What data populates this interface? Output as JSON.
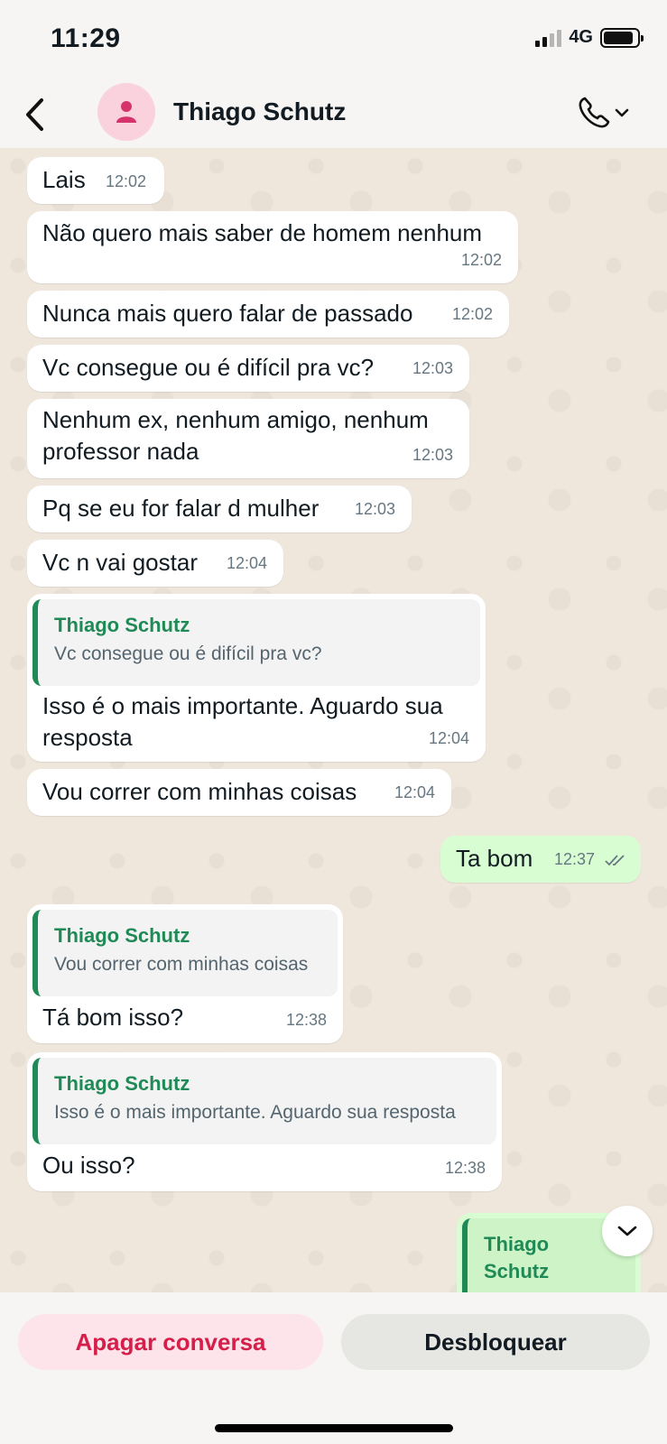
{
  "status_bar": {
    "time": "11:29",
    "network": "4G"
  },
  "header": {
    "contact_name": "Thiago Schutz"
  },
  "messages": [
    {
      "text": "Lais",
      "time": "12:02"
    },
    {
      "text": "Não quero mais saber de homem nenhum",
      "time": "12:02"
    },
    {
      "text": "Nunca mais quero falar de passado",
      "time": "12:02"
    },
    {
      "text": "Vc consegue ou é difícil pra vc?",
      "time": "12:03"
    },
    {
      "text": "Nenhum ex, nenhum amigo, nenhum professor nada",
      "time": "12:03"
    },
    {
      "text": "Pq se eu for falar d mulher",
      "time": "12:03"
    },
    {
      "text": "Vc n vai gostar",
      "time": "12:04"
    },
    {
      "quote_author": "Thiago Schutz",
      "quote_text": "Vc consegue ou é difícil pra vc?",
      "text": "Isso é o mais importante. Aguardo sua resposta",
      "time": "12:04"
    },
    {
      "text": "Vou correr com minhas coisas",
      "time": "12:04"
    },
    {
      "text": "Ta bom",
      "time": "12:37",
      "outgoing": true
    },
    {
      "quote_author": "Thiago Schutz",
      "quote_text": "Vou correr com minhas coisas",
      "text": "Tá bom isso?",
      "time": "12:38"
    },
    {
      "quote_author": "Thiago Schutz",
      "quote_text": "Isso é o mais importante. Aguardo sua resposta",
      "text": "Ou isso?",
      "time": "12:38"
    },
    {
      "quote_author": "Thiago Schutz",
      "outgoing": true
    }
  ],
  "actions": {
    "delete_label": "Apagar conversa",
    "unblock_label": "Desbloquear"
  },
  "colors": {
    "accent_green": "#1f8a56",
    "delete_red": "#d51f4a",
    "outgoing_bubble": "#d9fdd3"
  },
  "icons": [
    "back-chevron-icon",
    "person-icon",
    "phone-icon",
    "chevron-down-icon",
    "double-check-icon"
  ]
}
